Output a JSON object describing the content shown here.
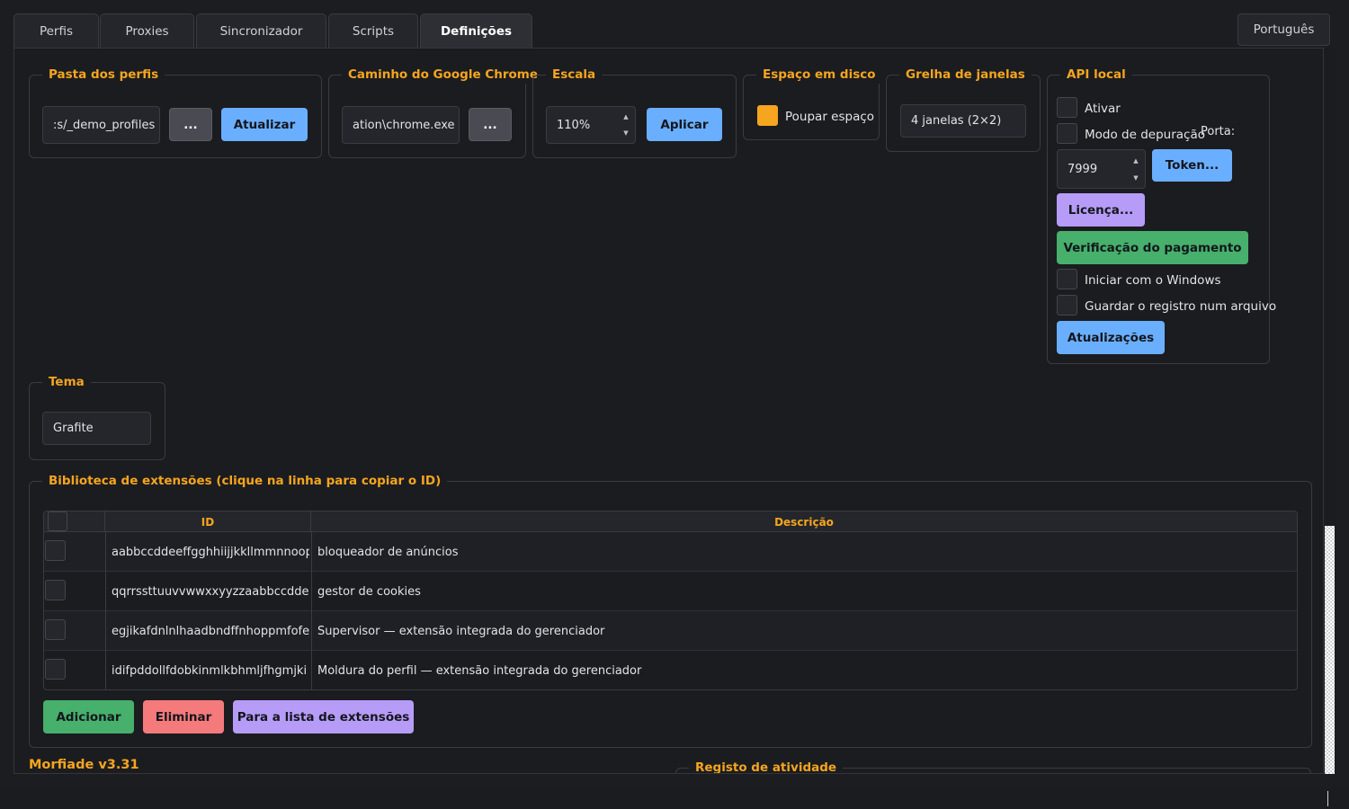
{
  "tabs": [
    {
      "label": "Perfis"
    },
    {
      "label": "Proxies"
    },
    {
      "label": "Sincronizador"
    },
    {
      "label": "Scripts"
    },
    {
      "label": "Definições",
      "active": true
    }
  ],
  "language": "Português",
  "profiles_folder": {
    "title": "Pasta dos perfis",
    "value": ":s/_demo_profiles",
    "browse_label": "...",
    "refresh_label": "Atualizar"
  },
  "chrome_path": {
    "title": "Caminho do Google Chrome",
    "value": "ation\\chrome.exe",
    "browse_label": "..."
  },
  "scale": {
    "title": "Escala",
    "value": "110%",
    "apply_label": "Aplicar"
  },
  "disk_space": {
    "title": "Espaço em disco",
    "save_label": "Poupar espaço",
    "checked": true
  },
  "window_grid": {
    "title": "Grelha de janelas",
    "value": "4 janelas (2×2)"
  },
  "local_api": {
    "title": "API local",
    "enable_label": "Ativar",
    "debug_label": "Modo de depuração",
    "port_label": "Porta:",
    "port_value": "7999",
    "token_label": "Token...",
    "license_label": "Licença...",
    "payment_label": "Verificação do pagamento",
    "startup_label": "Iniciar com o Windows",
    "log_file_label": "Guardar o registro num arquivo",
    "updates_label": "Atualizações"
  },
  "theme": {
    "title": "Tema",
    "value": "Grafite"
  },
  "extensions": {
    "title": "Biblioteca de extensões (clique na linha para copiar o ID)",
    "columns": {
      "id": "ID",
      "description": "Descrição"
    },
    "rows": [
      {
        "id": "aabbccddeeffgghhiijjkkllmmnnoopp",
        "description": "bloqueador de anúncios"
      },
      {
        "id": "qqrrssttuuvvwwxxyyzzaabbccddeeff",
        "description": "gestor de cookies"
      },
      {
        "id": "egjikafdnlnlhaadbndffnhoppmfofej",
        "description": "Supervisor — extensão integrada do gerenciador"
      },
      {
        "id": "idifpddollfdobkinmlkbhmljfhgmjki",
        "description": "Moldura do perfil — extensão integrada do gerenciador"
      }
    ],
    "add_label": "Adicionar",
    "delete_label": "Eliminar",
    "store_label": "Para a lista de extensões"
  },
  "brand": "Morfiade v3.31",
  "activity_log_title": "Registo de atividade",
  "colors": {
    "accent": "#f5a51e",
    "primary": "#6aafff",
    "success": "#46b06c",
    "danger": "#f57a7c",
    "violet": "#b69cf7"
  }
}
